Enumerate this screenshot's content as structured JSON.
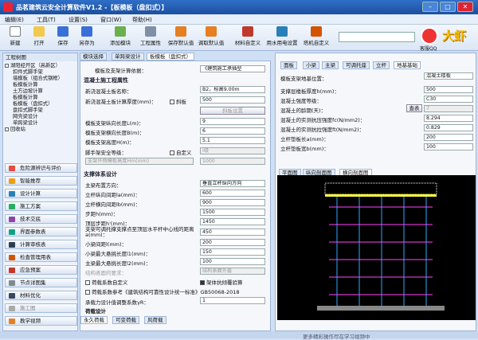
{
  "titlebar": {
    "title": "品茗建筑云安全计算软件V1.2 -【板模板（盘扣式）】"
  },
  "menu": [
    "编辑(E)",
    "工具(T)",
    "设置(S)",
    "窗口(W)",
    "帮助(H)"
  ],
  "toolbar": [
    "新建",
    "打开",
    "保存",
    "另存为",
    "添加模块",
    "工程属性",
    "保存默认值",
    "调取默认值",
    "材料自定义",
    "用水用电设置",
    "塔机自定义"
  ],
  "qq_label": "客服QQ",
  "brand": "大虾",
  "left": {
    "header": "工程树图",
    "tree": [
      "湖阳经开区（高新区）",
      "扣件式脚手架",
      "墙模板（组合式钢框）",
      "板模板计算",
      "土方边坡计算",
      "板模板计算",
      "板模板（盘扣式）",
      "盘扣式脚手架",
      "网壳梁设计",
      "单跨梁设计",
      "回收站"
    ],
    "side": [
      "危险源辨识与评价",
      "智能推荐",
      "设计计算",
      "施工方案",
      "技术交底",
      "界面参数表",
      "计算审核表",
      "检查管理用表",
      "应急预案",
      "节点详图集",
      "材料优化",
      "施工图",
      "教学视频"
    ]
  },
  "mid_tabs": [
    "模块选择",
    "单跨梁设计",
    "板模板（盘扣式）"
  ],
  "mid": {
    "lbl_basis": "模板及支架计算依据：",
    "val_basis": "《建筑施工承插型",
    "sec1": "混凝土施工程属性",
    "l1": "新浇混凝土板名称：",
    "v1": "B2，标高9.00m",
    "l2": "新浇混凝土板计算厚度(mm)：",
    "v2": "500",
    "chk_slab": "斜板",
    "btn_calc": "斜板设置",
    "l3": "模板支架纵向长度L(m)：",
    "v3": "9",
    "l4": "模板支架横向长度B(m)：",
    "v4": "6",
    "l5": "模板支架高度H(m)：",
    "v5": "5.1",
    "l6": "脚手架安全等级：",
    "v6": "I级",
    "chk_custom": "自定义",
    "l7": "支架外侧模板高度Hm(mm)",
    "v7": "1000",
    "sec2": "支撑体系设计",
    "l8": "主梁布置方向：",
    "v8": "垂直立杆纵向方向",
    "l9": "立杆纵向间距la(mm)：",
    "v9": "600",
    "l10": "立杆横向间距lb(mm)：",
    "v10": "900",
    "l11": "步距h(mm)：",
    "v11": "1500",
    "l12": "顶层步距h'(mm)：",
    "v12": "1450",
    "l13": "支架可调托撑支撑点至顶层水平杆中心线的距离a(mm)：",
    "v13": "450",
    "l14": "小梁间距l(mm)：",
    "v14": "200",
    "l15": "小梁最大悬挑长度l1(mm)：",
    "v15": "150",
    "l16": "主梁最大悬挑长度l2(mm)：",
    "v16": "100",
    "l17": "结构表面的要求：",
    "v17": "结构表面外露",
    "chk_a": "荷载系数自定义",
    "chk_b": "架体抗倾覆验算",
    "chk_c": "荷载系数参考《建筑结构可靠性设计统一标准》GB50068-2018",
    "l18": "承载力设计值调整系数γR：",
    "v18": "1",
    "l19": "荷载设计"
  },
  "mid_bottom_tabs": [
    "永久荷载",
    "可变荷载",
    "风荷载"
  ],
  "right_tabs": [
    "面板",
    "小梁",
    "主梁",
    "可调托座",
    "立杆",
    "地基基础"
  ],
  "right": {
    "l0": "模板支架地基位置：",
    "v0": "混凝土楼板",
    "l1": "支撑层楼板厚度h(mm)：",
    "v1": "500",
    "l2": "混凝土强度等级：",
    "v2": "C30",
    "l3": "混凝土的龄期(天)：",
    "v3": "7",
    "btn_lookup": "查表",
    "l4": "混凝土的实测抗压强度fc(N/mm2)：",
    "v4": "8.294",
    "l5": "混凝土的实测抗拉强度ft(N/mm2)：",
    "v5": "0.829",
    "l6": "立杆垫板长a(mm)：",
    "v6": "200",
    "l7": "立杆垫板宽b(mm)：",
    "v7": "100"
  },
  "draw_tabs": [
    "平面图",
    "纵向剖面图",
    "横向剖面图"
  ],
  "status": "更多精彩操作尽在学习视频中",
  "chart_colors": {
    "grid": "#ff44ff",
    "line": "#2ea8ff",
    "concrete": "#ffffff"
  }
}
